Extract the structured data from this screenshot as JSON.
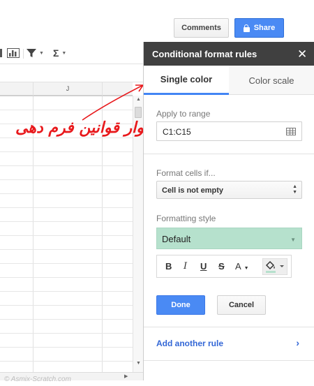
{
  "header": {
    "comments_label": "Comments",
    "share_label": "Share"
  },
  "toolbar": {
    "items": [
      "chart-icon",
      "filter-icon",
      "functions-icon"
    ],
    "function_glyph": "Σ"
  },
  "sheet": {
    "column_label": "J"
  },
  "annotation": {
    "text": "نوار قوانین فرم دهی",
    "color": "#e8191c"
  },
  "panel": {
    "title": "Conditional format rules",
    "tabs": [
      {
        "label": "Single color",
        "active": true
      },
      {
        "label": "Color scale",
        "active": false
      }
    ],
    "apply_range": {
      "label": "Apply to range",
      "value": "C1:C15"
    },
    "condition": {
      "label": "Format cells if...",
      "selected": "Cell is not empty"
    },
    "formatting": {
      "label": "Formatting style",
      "selected": "Default",
      "color": "#b6e1cd",
      "buttons": [
        "B",
        "I",
        "U",
        "S",
        "A"
      ]
    },
    "done_label": "Done",
    "cancel_label": "Cancel",
    "add_rule_label": "Add another rule"
  },
  "watermark": "© Asmix-Scratch.com",
  "colors": {
    "accent": "#4a8af4",
    "panel_header": "#404040",
    "link": "#3367d6"
  }
}
